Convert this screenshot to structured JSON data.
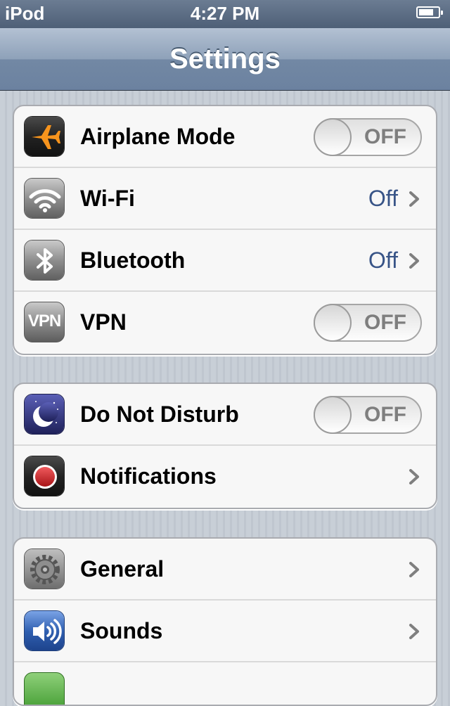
{
  "status_bar": {
    "carrier": "iPod",
    "time": "4:27 PM"
  },
  "nav_bar": {
    "title": "Settings"
  },
  "groups": [
    {
      "rows": [
        {
          "label": "Airplane Mode",
          "icon": "airplane-icon",
          "control": "toggle",
          "toggle_text": "OFF"
        },
        {
          "label": "Wi-Fi",
          "icon": "wifi-icon",
          "value": "Off",
          "control": "chevron"
        },
        {
          "label": "Bluetooth",
          "icon": "bluetooth-icon",
          "value": "Off",
          "control": "chevron"
        },
        {
          "label": "VPN",
          "icon": "vpn-icon",
          "icon_text": "VPN",
          "control": "toggle",
          "toggle_text": "OFF"
        }
      ]
    },
    {
      "rows": [
        {
          "label": "Do Not Disturb",
          "icon": "moon-icon",
          "control": "toggle",
          "toggle_text": "OFF"
        },
        {
          "label": "Notifications",
          "icon": "notifications-icon",
          "control": "chevron"
        }
      ]
    },
    {
      "rows": [
        {
          "label": "General",
          "icon": "gear-icon",
          "control": "chevron"
        },
        {
          "label": "Sounds",
          "icon": "speaker-icon",
          "control": "chevron"
        }
      ]
    }
  ],
  "colors": {
    "value_text": "#385487",
    "airplane_orange": "#f7941d",
    "notification_red": "#d7262a",
    "sounds_blue": "#2f5fb0"
  }
}
